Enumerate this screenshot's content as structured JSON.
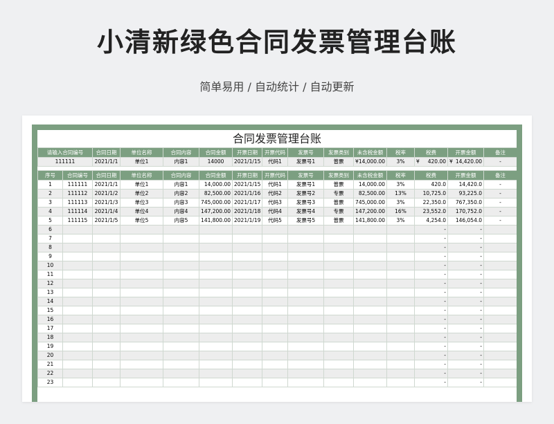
{
  "page": {
    "title": "小清新绿色合同发票管理台账",
    "subtitle": "简单易用 / 自动统计 / 自动更新"
  },
  "sheet": {
    "title": "合同发票管理台账",
    "colors": {
      "header_green": "#7c9f81",
      "stripe_gray": "#ededed"
    },
    "lookup": {
      "headers": [
        "请输入合同编号",
        "合同日期",
        "单位名称",
        "合同内容",
        "合同金额",
        "开票日期",
        "开票代码",
        "发票号",
        "发票类别",
        "未含税金额",
        "税率",
        "税费",
        "开票金额",
        "备注"
      ],
      "values": [
        "111111",
        "2021/1/1",
        "单位1",
        "内容1",
        "14000",
        "2021/1/15",
        "代码1",
        "发票号1",
        "普票",
        "¥",
        "14,000.00",
        "3%",
        "¥",
        "420.00",
        "¥",
        "14,420.00",
        "-"
      ]
    },
    "table": {
      "headers": [
        "序号",
        "合同编号",
        "合同日期",
        "单位名称",
        "合同内容",
        "合同金额",
        "开票日期",
        "开票代码",
        "发票号",
        "发票类别",
        "未含税金额",
        "税率",
        "税费",
        "开票金额",
        "备注"
      ],
      "rows": [
        [
          "1",
          "111111",
          "2021/1/1",
          "单位1",
          "内容1",
          "14,000.00",
          "2021/1/15",
          "代码1",
          "发票号1",
          "普票",
          "14,000.00",
          "3%",
          "420.0",
          "14,420.0",
          "-"
        ],
        [
          "2",
          "111112",
          "2021/1/2",
          "单位2",
          "内容2",
          "82,500.00",
          "2021/1/16",
          "代码2",
          "发票号2",
          "专票",
          "82,500.00",
          "13%",
          "10,725.0",
          "93,225.0",
          "-"
        ],
        [
          "3",
          "111113",
          "2021/1/3",
          "单位3",
          "内容3",
          "745,000.00",
          "2021/1/17",
          "代码3",
          "发票号3",
          "普票",
          "745,000.00",
          "3%",
          "22,350.0",
          "767,350.0",
          "-"
        ],
        [
          "4",
          "111114",
          "2021/1/4",
          "单位4",
          "内容4",
          "147,200.00",
          "2021/1/18",
          "代码4",
          "发票号4",
          "专票",
          "147,200.00",
          "16%",
          "23,552.0",
          "170,752.0",
          "-"
        ],
        [
          "5",
          "111115",
          "2021/1/5",
          "单位5",
          "内容5",
          "141,800.00",
          "2021/1/19",
          "代码5",
          "发票号5",
          "普票",
          "141,800.00",
          "3%",
          "4,254.0",
          "146,054.0",
          "-"
        ],
        [
          "6",
          "",
          "",
          "",
          "",
          "",
          "",
          "",
          "",
          "",
          "",
          "",
          "-",
          "-",
          ""
        ],
        [
          "7",
          "",
          "",
          "",
          "",
          "",
          "",
          "",
          "",
          "",
          "",
          "",
          "-",
          "-",
          ""
        ],
        [
          "8",
          "",
          "",
          "",
          "",
          "",
          "",
          "",
          "",
          "",
          "",
          "",
          "-",
          "-",
          ""
        ],
        [
          "9",
          "",
          "",
          "",
          "",
          "",
          "",
          "",
          "",
          "",
          "",
          "",
          "-",
          "-",
          ""
        ],
        [
          "10",
          "",
          "",
          "",
          "",
          "",
          "",
          "",
          "",
          "",
          "",
          "",
          "-",
          "-",
          ""
        ],
        [
          "11",
          "",
          "",
          "",
          "",
          "",
          "",
          "",
          "",
          "",
          "",
          "",
          "-",
          "-",
          ""
        ],
        [
          "12",
          "",
          "",
          "",
          "",
          "",
          "",
          "",
          "",
          "",
          "",
          "",
          "-",
          "-",
          ""
        ],
        [
          "13",
          "",
          "",
          "",
          "",
          "",
          "",
          "",
          "",
          "",
          "",
          "",
          "-",
          "-",
          ""
        ],
        [
          "14",
          "",
          "",
          "",
          "",
          "",
          "",
          "",
          "",
          "",
          "",
          "",
          "-",
          "-",
          ""
        ],
        [
          "15",
          "",
          "",
          "",
          "",
          "",
          "",
          "",
          "",
          "",
          "",
          "",
          "-",
          "-",
          ""
        ],
        [
          "16",
          "",
          "",
          "",
          "",
          "",
          "",
          "",
          "",
          "",
          "",
          "",
          "-",
          "-",
          ""
        ],
        [
          "17",
          "",
          "",
          "",
          "",
          "",
          "",
          "",
          "",
          "",
          "",
          "",
          "-",
          "-",
          ""
        ],
        [
          "18",
          "",
          "",
          "",
          "",
          "",
          "",
          "",
          "",
          "",
          "",
          "",
          "-",
          "-",
          ""
        ],
        [
          "19",
          "",
          "",
          "",
          "",
          "",
          "",
          "",
          "",
          "",
          "",
          "",
          "-",
          "-",
          ""
        ],
        [
          "20",
          "",
          "",
          "",
          "",
          "",
          "",
          "",
          "",
          "",
          "",
          "",
          "-",
          "-",
          ""
        ],
        [
          "21",
          "",
          "",
          "",
          "",
          "",
          "",
          "",
          "",
          "",
          "",
          "",
          "-",
          "-",
          ""
        ],
        [
          "22",
          "",
          "",
          "",
          "",
          "",
          "",
          "",
          "",
          "",
          "",
          "",
          "-",
          "-",
          ""
        ],
        [
          "23",
          "",
          "",
          "",
          "",
          "",
          "",
          "",
          "",
          "",
          "",
          "",
          "-",
          "-",
          ""
        ]
      ]
    }
  }
}
